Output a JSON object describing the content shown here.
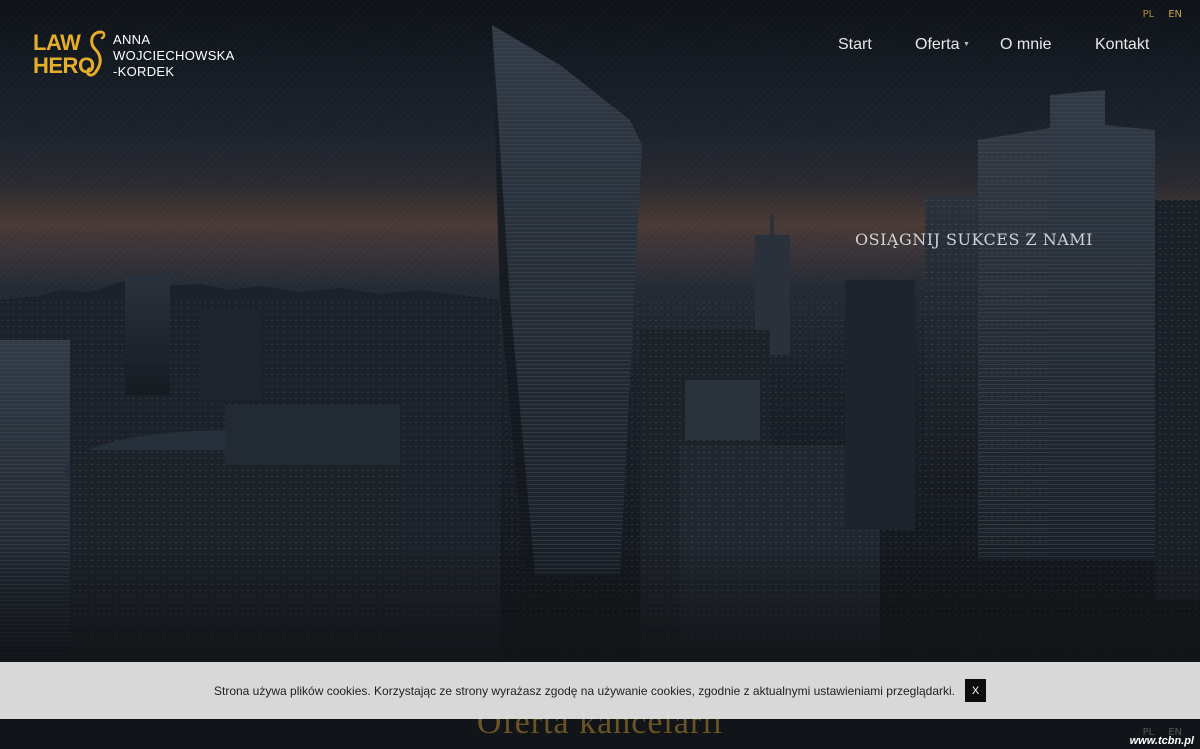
{
  "language_switcher": {
    "items": [
      "PL",
      "EN"
    ],
    "active": "PL"
  },
  "logo": {
    "mark_top": "LAW",
    "mark_bottom": "HERO",
    "name_lines": [
      "ANNA",
      "WOJCIECHOWSKA",
      "-KORDEK"
    ]
  },
  "nav": {
    "items": [
      "Start",
      "Oferta",
      "O mnie",
      "Kontakt"
    ]
  },
  "hero": {
    "tagline": "OSIĄGNIJ SUKCES Z NAMI"
  },
  "section": {
    "title": "Oferta kancelarii"
  },
  "cookie_banner": {
    "text": "Strona używa plików cookies. Korzystając ze strony wyrażasz zgodę na używanie cookies, zgodnie z aktualnymi ustawieniami przeglądarki.",
    "close_label": "X"
  },
  "watermark": "www.tcbn.pl",
  "colors": {
    "accent": "#e6ad2a",
    "background": "#111418",
    "cookie_bg": "#e1e1e1"
  }
}
